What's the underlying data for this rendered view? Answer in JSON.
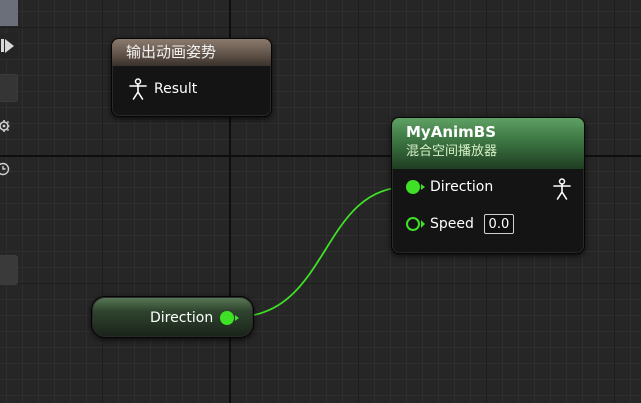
{
  "canvas": {
    "background": "#262626",
    "wire_color": "#3fe126"
  },
  "output_node": {
    "title": "输出动画姿势",
    "pin_label": "Result",
    "header_color": "#7a6a5e"
  },
  "blendspace_node": {
    "title": "MyAnimBS",
    "subtitle": "混合空间播放器",
    "header_color": "#4f8a55",
    "pins": [
      {
        "label": "Direction",
        "connected": true
      },
      {
        "label": "Speed",
        "connected": false,
        "value": "0.0"
      }
    ]
  },
  "variable_node": {
    "label": "Direction"
  },
  "icons": {
    "person": "person-pose-icon",
    "play": "play-icon",
    "gear": "gear-icon",
    "clock": "clock-icon"
  }
}
